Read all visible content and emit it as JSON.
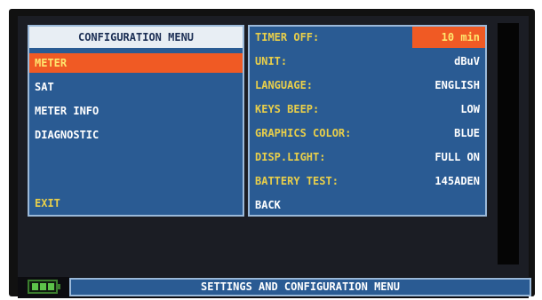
{
  "config_menu": {
    "title": "CONFIGURATION MENU",
    "items": [
      {
        "label": "METER",
        "selected": true
      },
      {
        "label": "SAT"
      },
      {
        "label": "METER INFO"
      },
      {
        "label": "DIAGNOSTIC"
      }
    ],
    "exit_label": "EXIT"
  },
  "settings": {
    "rows": [
      {
        "label": "TIMER OFF:",
        "value": "10 min"
      },
      {
        "label": "UNIT:",
        "value": "dBuV"
      },
      {
        "label": "LANGUAGE:",
        "value": "ENGLISH"
      },
      {
        "label": "KEYS BEEP:",
        "value": "LOW"
      },
      {
        "label": "GRAPHICS COLOR:",
        "value": "BLUE"
      },
      {
        "label": "DISP.LIGHT:",
        "value": "FULL ON"
      },
      {
        "label": "BATTERY TEST:",
        "value": "145ADEN"
      }
    ],
    "back_label": "BACK"
  },
  "status_bar": {
    "text": "SETTINGS AND CONFIGURATION MENU",
    "battery_icon": "battery-icon"
  },
  "colors": {
    "panel_blue": "#2a5b93",
    "highlight_orange": "#f05a24",
    "label_yellow": "#e9cf4a"
  }
}
